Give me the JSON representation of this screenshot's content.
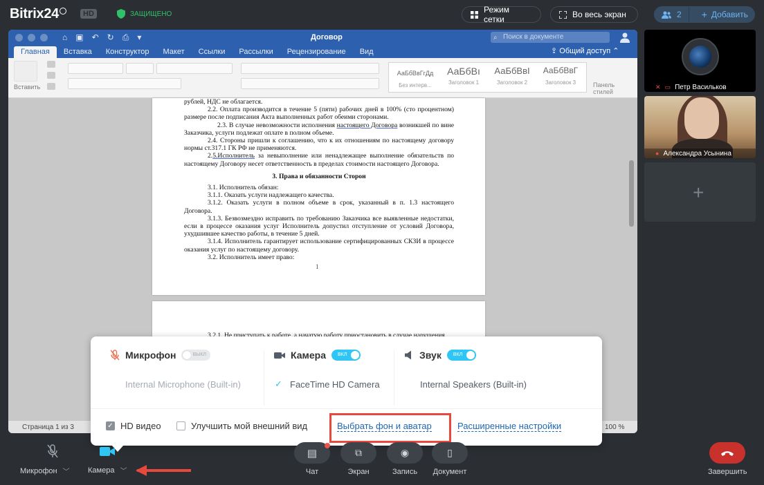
{
  "topbar": {
    "logo": "Bitrix24",
    "hd": "HD",
    "secure": "ЗАЩИЩЕНО",
    "grid_btn": "Режим сетки",
    "fullscreen_btn": "Во весь экран",
    "users_count": "2",
    "add_btn": "Добавить"
  },
  "word": {
    "doc_title": "Договор",
    "search_placeholder": "Поиск в документе",
    "tabs": [
      "Главная",
      "Вставка",
      "Конструктор",
      "Макет",
      "Ссылки",
      "Рассылки",
      "Рецензирование",
      "Вид"
    ],
    "share": "Общий доступ",
    "paste_label": "Вставить",
    "styles": [
      {
        "preview": "АаБбВвГгДд",
        "name": "Без интерв..."
      },
      {
        "preview": "АаБбВı",
        "name": "Заголовок 1"
      },
      {
        "preview": "АаБбВвI",
        "name": "Заголовок 2"
      },
      {
        "preview": "АаБбВвГ",
        "name": "Заголовок 3"
      }
    ],
    "panel_label_1": "Панель",
    "panel_label_2": "стилей",
    "status_page": "Страница 1 из 3",
    "status_zoom": "100 %",
    "page_number": "1",
    "doc": {
      "l1": "рублей, НДС не облагается.",
      "p22": "2.2. Оплата производится в течение 5 (пяти) рабочих дней в 100% (сто процентном) размере после подписания Акта выполненных работ обеими сторонами.",
      "p23a": "2.3. В случае невозможности исполнения ",
      "p23u": "настоящего Договора",
      "p23b": " возникшей по вине Заказчика, услуги подлежат оплате в полном объеме.",
      "p24": "2.4. Стороны пришли к соглашению, что к их отношениям по настоящему договору нормы ст.317.1 ГК РФ не применяются.",
      "p25a": "2.",
      "p25u": "5.Исполнитель",
      "p25b": " за невыполнение или ненадлежащее выполнение обязательств по настоящему Договору несет ответственность в пределах стоимости настоящего Договора.",
      "h3": "3. Права и обязанности Сторон",
      "p31": "3.1. Исполнитель обязан:",
      "p311": "3.1.1. Оказать услуги надлежащего качества.",
      "p312": "3.1.2. Оказать услуги в полном объеме в срок, указанный в п. 1.3 настоящего Договора.",
      "p313": "3.1.3. Безвозмездно исправить по требованию Заказчика все выявленные недостатки, если в процессе оказания услуг Исполнитель допустил отступление от условий Договора, ухудшившее качество работы, в течение 5 дней.",
      "p314": "3.1.4. Исполнитель гарантирует использование сертифицированных СКЗИ в процессе оказания услуг по настоящему договору.",
      "p32": "3.2. Исполнитель имеет право:",
      "p321": "3.2.1. Не приступать к работе, а начатую работу приостановить в случае нарушения"
    }
  },
  "participants": {
    "p1_name": "Петр Васильков",
    "p2_name": "Александра Усынина"
  },
  "popup": {
    "mic_label": "Микрофон",
    "mic_toggle": "ВЫКЛ",
    "mic_device": "Internal Microphone (Built-in)",
    "cam_label": "Камера",
    "cam_toggle": "ВКЛ",
    "cam_device": "FaceTime HD Camera",
    "sound_label": "Звук",
    "sound_toggle": "ВКЛ",
    "sound_device": "Internal Speakers (Built-in)",
    "hd_video": "HD видео",
    "improve_look": "Улучшить мой внешний вид",
    "choose_bg": "Выбрать фон и аватар",
    "advanced": "Расширенные настройки"
  },
  "controls": {
    "mic": "Микрофон",
    "camera": "Камера",
    "chat": "Чат",
    "screen": "Экран",
    "record": "Запись",
    "document": "Документ",
    "end": "Завершить"
  },
  "colors": {
    "accent_blue": "#2fc6f6",
    "link_blue": "#2067b0",
    "highlight_red": "#e8493d",
    "end_call_red": "#c9312d",
    "word_blue": "#2d61b0"
  }
}
